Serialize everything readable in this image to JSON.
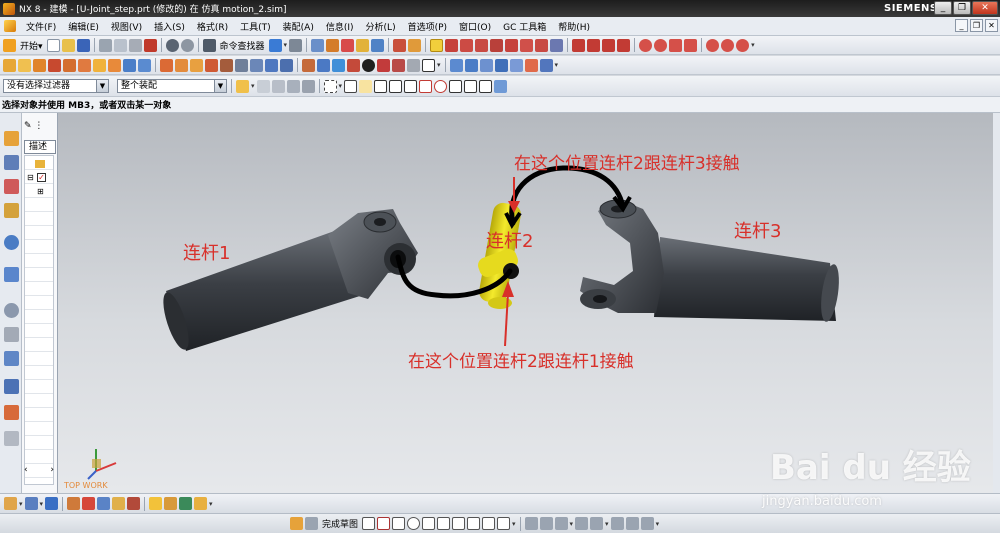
{
  "window": {
    "title": "NX 8 - 建模 - [U-Joint_step.prt   (修改的)   在 仿真 motion_2.sim]",
    "brand": "SIEMENS",
    "minimize": "_",
    "restore": "❐",
    "close": "✕"
  },
  "menu": {
    "items": [
      "文件(F)",
      "编辑(E)",
      "视图(V)",
      "插入(S)",
      "格式(R)",
      "工具(T)",
      "装配(A)",
      "信息(I)",
      "分析(L)",
      "首选项(P)",
      "窗口(O)",
      "GC 工具箱",
      "帮助(H)"
    ]
  },
  "toolbar1": {
    "start_label": "开始▾",
    "command_finder_label": "命令查找器"
  },
  "selection": {
    "filter_value": "没有选择过滤器",
    "scope_value": "整个装配"
  },
  "cue": {
    "text": "选择对象并使用 MB3，或者双击某一对象"
  },
  "navigator": {
    "tab_label": "描述"
  },
  "annotations": {
    "link1": "连杆1",
    "link2": "连杆2",
    "link3": "连杆3",
    "top_note": "在这个位置连杆2跟连杆3接触",
    "bottom_note": "在这个位置连杆2跟连杆1接触"
  },
  "triad": {
    "label": "TOP WORK"
  },
  "bottom_toolbar": {
    "sketch_label": "完成草图"
  },
  "watermark": {
    "main": "Bai du 经验",
    "url": "jingyan.baidu.com"
  },
  "colors": {
    "annotation_red": "#d8302a",
    "link2_yellow": "#e8dc1a",
    "part_gray": "#3f4348"
  }
}
